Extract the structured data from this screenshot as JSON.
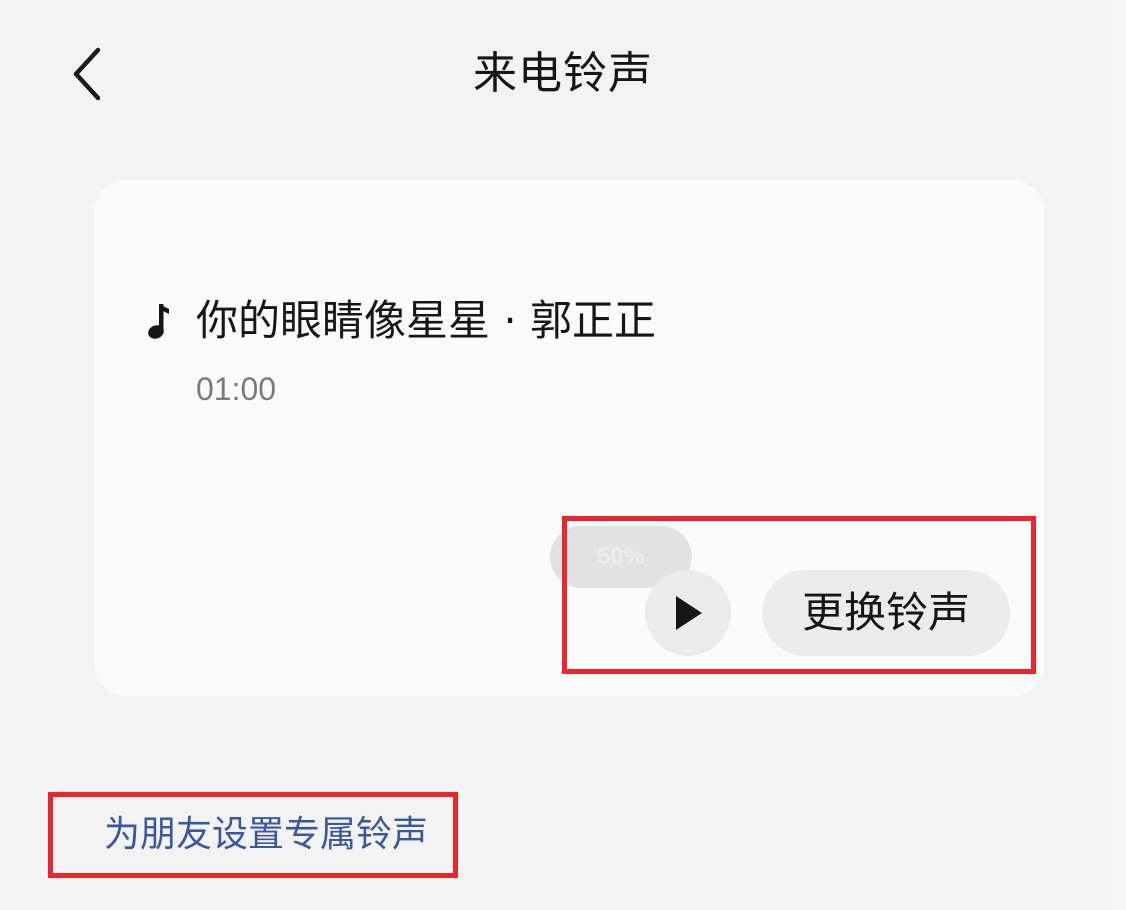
{
  "header": {
    "back_icon": "chevron-left-icon",
    "title": "来电铃声"
  },
  "ringtone_card": {
    "note_icon": "music-note-icon",
    "song_title": "你的眼睛像星星 · 郭正正",
    "duration": "01:00",
    "volume_badge": "50%",
    "play_icon": "play-icon",
    "change_button_label": "更换铃声"
  },
  "friend_link": {
    "label": "为朋友设置专属铃声"
  },
  "colors": {
    "background": "#f3f3f4",
    "card": "#fbfbfc",
    "button_bg": "#ececed",
    "link": "#3b57a0",
    "highlight": "#e8262b"
  }
}
